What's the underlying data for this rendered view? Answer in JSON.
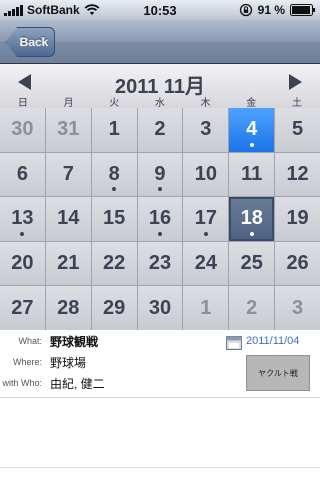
{
  "status_bar": {
    "carrier": "SoftBank",
    "time": "10:53",
    "battery": "91 %",
    "icons": [
      "signal-icon",
      "wifi-icon",
      "orientation-lock-icon",
      "battery-icon"
    ]
  },
  "nav": {
    "back_label": "Back"
  },
  "calendar": {
    "month_title": "2011 11月",
    "weekdays": [
      "日",
      "月",
      "火",
      "水",
      "木",
      "金",
      "土"
    ],
    "days": [
      {
        "label": "30",
        "muted": true,
        "dot": false
      },
      {
        "label": "31",
        "muted": true,
        "dot": false
      },
      {
        "label": "1",
        "dot": false
      },
      {
        "label": "2",
        "dot": false
      },
      {
        "label": "3",
        "dot": false
      },
      {
        "label": "4",
        "dot": true,
        "today": true
      },
      {
        "label": "5",
        "dot": false
      },
      {
        "label": "6",
        "dot": false
      },
      {
        "label": "7",
        "dot": false
      },
      {
        "label": "8",
        "dot": true
      },
      {
        "label": "9",
        "dot": true
      },
      {
        "label": "10",
        "dot": false
      },
      {
        "label": "11",
        "dot": false
      },
      {
        "label": "12",
        "dot": false
      },
      {
        "label": "13",
        "dot": true
      },
      {
        "label": "14",
        "dot": false
      },
      {
        "label": "15",
        "dot": false
      },
      {
        "label": "16",
        "dot": true
      },
      {
        "label": "17",
        "dot": true
      },
      {
        "label": "18",
        "dot": true,
        "selected": true
      },
      {
        "label": "19",
        "dot": false
      },
      {
        "label": "20",
        "dot": false
      },
      {
        "label": "21",
        "dot": false
      },
      {
        "label": "22",
        "dot": false
      },
      {
        "label": "23",
        "dot": false
      },
      {
        "label": "24",
        "dot": false
      },
      {
        "label": "25",
        "dot": false
      },
      {
        "label": "26",
        "dot": false
      },
      {
        "label": "27",
        "dot": false
      },
      {
        "label": "28",
        "dot": false
      },
      {
        "label": "29",
        "dot": false
      },
      {
        "label": "30",
        "dot": false
      },
      {
        "label": "1",
        "muted": true,
        "dot": false
      },
      {
        "label": "2",
        "muted": true,
        "dot": false
      },
      {
        "label": "3",
        "muted": true,
        "dot": false
      }
    ]
  },
  "event": {
    "what_label": "What:",
    "what_value": "野球観戦",
    "where_label": "Where:",
    "where_value": "野球場",
    "who_label": "with Who:",
    "who_value": "由紀, 健二",
    "date": "2011/11/04",
    "thumbnail_text": "ヤクルト戦"
  },
  "colors": {
    "today": "#1a74e8",
    "selected": "#4d6282",
    "date_link": "#3a6fc0"
  }
}
